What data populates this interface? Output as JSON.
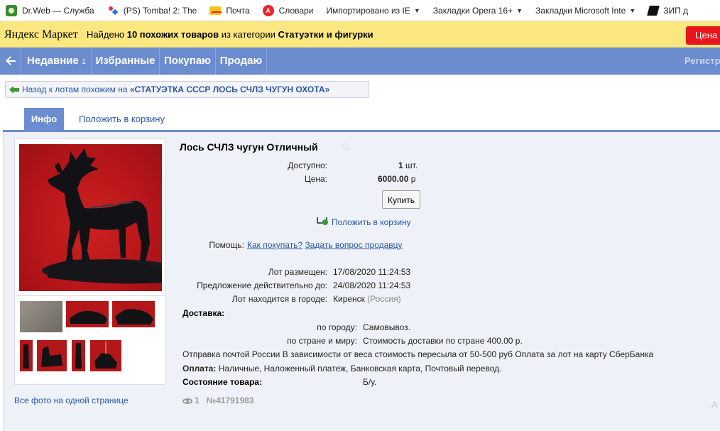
{
  "bookmarks": [
    {
      "label": "Dr.Web — Служба",
      "icon": "drweb-icon"
    },
    {
      "label": "(PS) Tomba! 2: The",
      "icon": "playstation-icon"
    },
    {
      "label": "Почта",
      "icon": "mail-icon"
    },
    {
      "label": "Словари",
      "icon": "dictionary-icon"
    },
    {
      "label": "Импортировано из IE",
      "icon": "folder-icon"
    },
    {
      "label": "Закладки Opera 16+",
      "icon": "folder-icon"
    },
    {
      "label": "Закладки Microsoft Inte",
      "icon": "folder-icon"
    },
    {
      "label": "ЗИП д",
      "icon": "gun-icon"
    }
  ],
  "header": {
    "logo": "Яндекс Маркет",
    "found_prefix": "Найдено",
    "found_count": "10 похожих товаров",
    "found_mid": "из категории",
    "found_category": "Статуэтки и фигурки",
    "button": "Цена с"
  },
  "nav": {
    "items": [
      {
        "label": "Недавние",
        "count": "1"
      },
      {
        "label": "Избранные"
      },
      {
        "label": "Покупаю"
      },
      {
        "label": "Продаю"
      }
    ],
    "right": "Регистр"
  },
  "back_link": {
    "prefix": "Назад к лотам похожим на",
    "target": "«СТАТУЭТКА СССР ЛОСЬ СЧЛЗ ЧУГУН ОХОТА»"
  },
  "tabs": {
    "info": "Инфо",
    "cart": "Положить в корзину"
  },
  "item": {
    "title": "Лось СЧЛЗ чугун Отличный",
    "available_label": "Доступно:",
    "available_value": "1",
    "available_unit": "шт.",
    "price_label": "Цена:",
    "price_value": "6000.00",
    "price_unit": "р",
    "buy_button": "Купить",
    "add_to_cart": "Положить в корзину",
    "help_label": "Помощь:",
    "help_link1": "Как покупать?",
    "help_link2": "Задать вопрос продавцу",
    "posted_label": "Лот размещен:",
    "posted_value": "17/08/2020 11:24:53",
    "valid_label": "Предложение действительно до:",
    "valid_value": "24/08/2020 11:24:53",
    "city_label": "Лот находится в городе:",
    "city_value": "Киренск",
    "city_country": "(Россия)",
    "delivery_title": "Доставка:",
    "delivery_city_label": "по городу:",
    "delivery_city_value": "Самовывоз.",
    "delivery_world_label": "по стране и миру:",
    "delivery_world_value": "Стоимость доставки по стране 400.00 р.",
    "shipping_note": "Отправка почтой России В зависимости от веса стоимость пересыла от 50-500 руб Оплата за лот на карту СберБанка",
    "payment_label": "Оплата:",
    "payment_value": "Наличные, Наложенный платеж, Банковская карта, Почтовый перевод.",
    "condition_label": "Состояние товара:",
    "condition_value": "Б/у.",
    "views": "1",
    "lot_number": "№41791983",
    "all_photos": "Все фото на одной странице"
  },
  "corner_text": "А"
}
